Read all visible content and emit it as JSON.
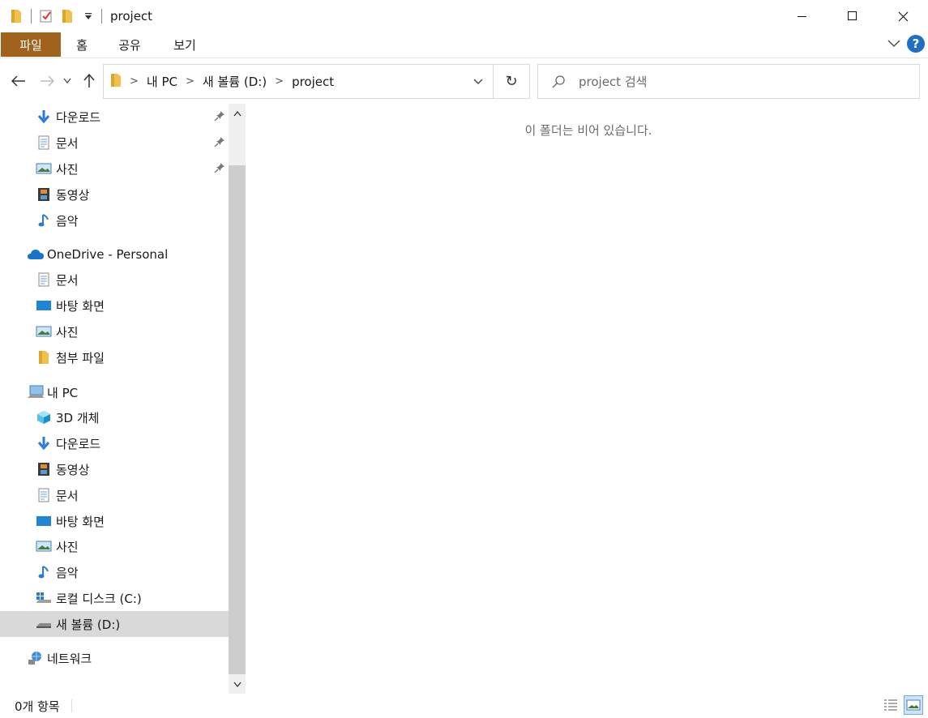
{
  "window": {
    "title": "project",
    "minimize_icon": "minimize-icon",
    "maximize_icon": "maximize-icon",
    "close_icon": "close-icon"
  },
  "ribbon": {
    "tabs": [
      {
        "label": "파일"
      },
      {
        "label": "홈"
      },
      {
        "label": "공유"
      },
      {
        "label": "보기"
      }
    ],
    "help_label": "?"
  },
  "address": {
    "crumbs": [
      "내 PC",
      "새 볼륨 (D:)",
      "project"
    ]
  },
  "search": {
    "placeholder": "project 검색"
  },
  "nav": {
    "quick_access": [
      {
        "label": "다운로드",
        "icon": "download-arrow-icon",
        "pinned": true
      },
      {
        "label": "문서",
        "icon": "document-icon",
        "pinned": true
      },
      {
        "label": "사진",
        "icon": "pictures-icon",
        "pinned": true
      },
      {
        "label": "동영상",
        "icon": "video-icon",
        "pinned": false
      },
      {
        "label": "음악",
        "icon": "music-icon",
        "pinned": false
      }
    ],
    "onedrive": {
      "label": "OneDrive - Personal",
      "items": [
        {
          "label": "문서"
        },
        {
          "label": "바탕 화면"
        },
        {
          "label": "사진"
        },
        {
          "label": "첨부 파일"
        }
      ]
    },
    "this_pc": {
      "label": "내 PC",
      "items": [
        {
          "label": "3D 개체"
        },
        {
          "label": "다운로드"
        },
        {
          "label": "동영상"
        },
        {
          "label": "문서"
        },
        {
          "label": "바탕 화면"
        },
        {
          "label": "사진"
        },
        {
          "label": "음악"
        },
        {
          "label": "로컬 디스크 (C:)"
        },
        {
          "label": "새 볼륨 (D:)"
        }
      ]
    },
    "network": {
      "label": "네트워크"
    }
  },
  "content": {
    "empty_message": "이 폴더는 비어 있습니다."
  },
  "status": {
    "item_count": "0개 항목"
  },
  "colors": {
    "file_tab": "#a0621c",
    "selection": "#d9d9d9",
    "accent_blue": "#1f6fc5",
    "folder_yellow": "#f0c24b"
  }
}
